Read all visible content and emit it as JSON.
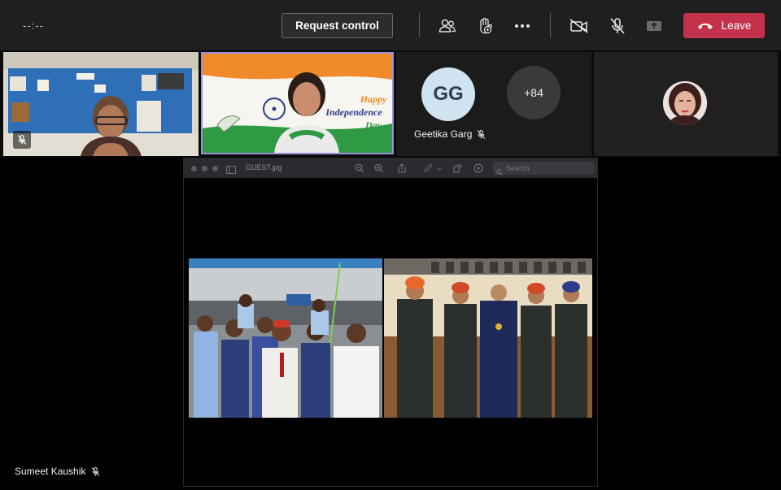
{
  "topbar": {
    "timer": "--:--",
    "request_control_label": "Request control",
    "leave_label": "Leave",
    "icons": [
      "participants-icon",
      "raise-hand-icon",
      "more-options-icon",
      "camera-off-icon",
      "mic-off-icon",
      "share-tray-icon",
      "phone-hangup-icon"
    ]
  },
  "participants": {
    "gg_initials": "GG",
    "gg_name": "Geetika Garg",
    "overflow_count": "+84"
  },
  "shared_content": {
    "filename": "GUEST.jpg",
    "search_placeholder": "Search"
  },
  "girl_tile": {
    "poster_line1": "Happy",
    "poster_line2": "Independence",
    "poster_line3": "Day"
  },
  "active_speaker": {
    "name": "Sumeet Kaushik"
  },
  "colors": {
    "leave": "#c4314b",
    "active_border": "#9b8fe0",
    "topbar": "#1f1f1f"
  }
}
